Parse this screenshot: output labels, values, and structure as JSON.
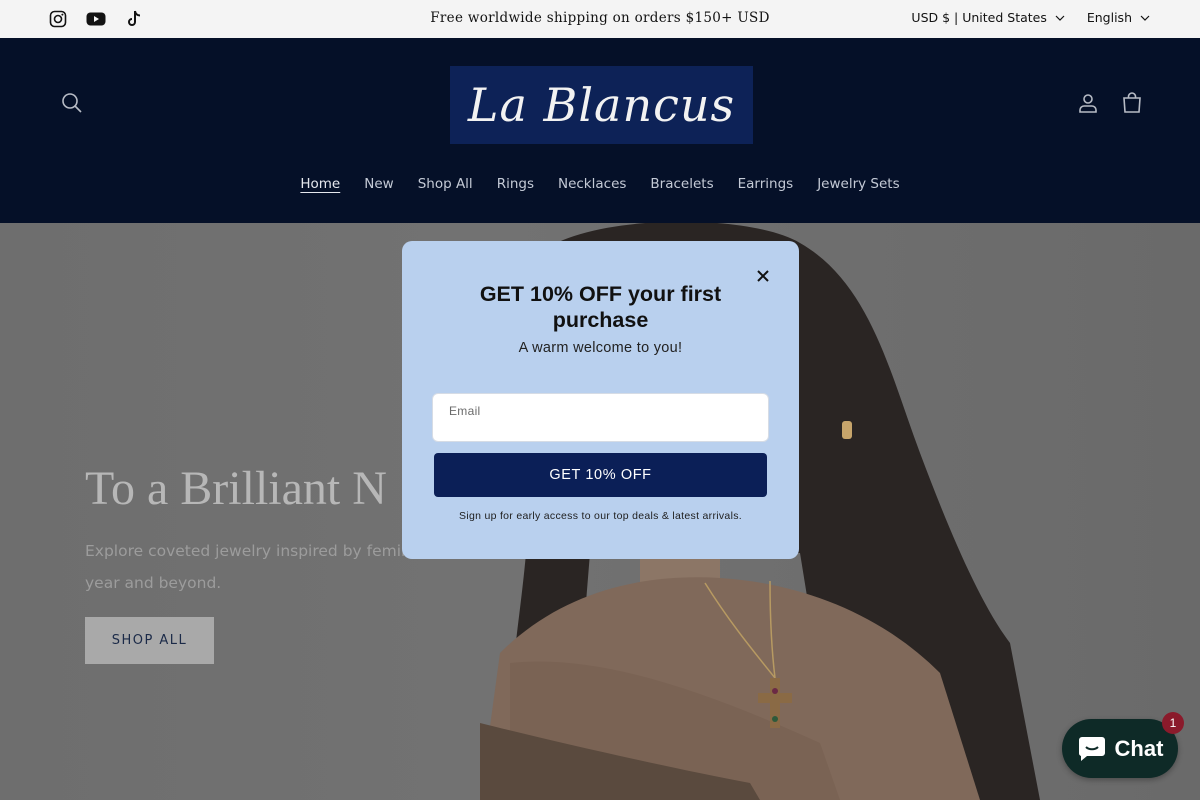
{
  "announcement": {
    "social_icons": [
      "instagram-icon",
      "youtube-icon",
      "tiktok-icon"
    ],
    "text": "Free worldwide shipping on orders $150+ USD",
    "currency": "USD $ | United States",
    "language": "English"
  },
  "header": {
    "logo_text": "La Blancus",
    "icons": [
      "search-icon",
      "account-icon",
      "cart-icon"
    ],
    "nav": [
      {
        "label": "Home",
        "active": true
      },
      {
        "label": "New"
      },
      {
        "label": "Shop All"
      },
      {
        "label": "Rings"
      },
      {
        "label": "Necklaces"
      },
      {
        "label": "Bracelets"
      },
      {
        "label": "Earrings"
      },
      {
        "label": "Jewelry Sets"
      }
    ]
  },
  "hero": {
    "title": "To a Brilliant N",
    "text": "Explore coveted jewelry inspired by femin year and beyond.",
    "text_line1": "Explore coveted jewelry inspired by femin",
    "text_line2": "year and beyond.",
    "button_label": "SHOP ALL"
  },
  "popup": {
    "title": "GET 10% OFF your first purchase",
    "subtitle": "A warm welcome to you!",
    "email_label": "Email",
    "email_value": "",
    "cta_label": "GET 10% OFF",
    "fine_print": "Sign up for early access to our top deals & latest arrivals."
  },
  "chat": {
    "label": "Chat",
    "badge": "1"
  },
  "colors": {
    "header_bg": "#0a1e4a",
    "popup_bg": "#b9d0ee",
    "cta_bg": "#0b1f57",
    "chat_bg": "#0e2a27",
    "badge_bg": "#8a1a2b"
  }
}
